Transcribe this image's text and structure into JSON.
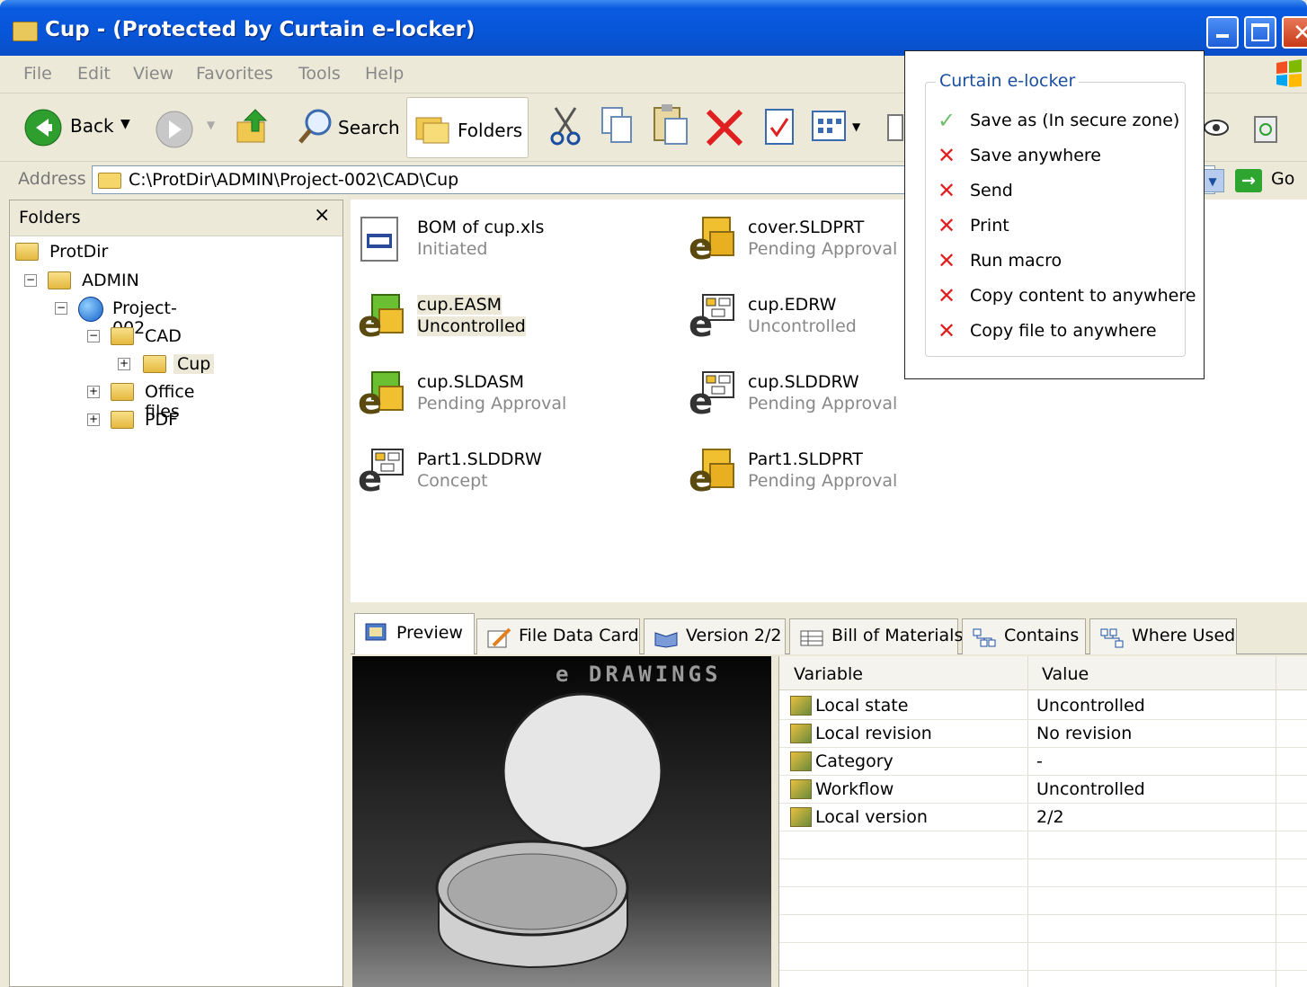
{
  "window": {
    "title": "Cup - (Protected by Curtain e-locker)"
  },
  "menu": [
    "File",
    "Edit",
    "View",
    "Favorites",
    "Tools",
    "Help"
  ],
  "toolbar": {
    "back": "Back",
    "search": "Search",
    "folders": "Folders",
    "go": "Go"
  },
  "address": {
    "label": "Address",
    "path": "C:\\ProtDir\\ADMIN\\Project-002\\CAD\\Cup"
  },
  "folders_pane": {
    "title": "Folders",
    "close": "×",
    "tree": [
      {
        "label": "ProtDir",
        "expander": ""
      },
      {
        "label": "ADMIN",
        "expander": "−"
      },
      {
        "label": "Project-002",
        "expander": "−"
      },
      {
        "label": "CAD",
        "expander": "−"
      },
      {
        "label": "Cup",
        "expander": "+"
      },
      {
        "label": "Office files",
        "expander": "+"
      },
      {
        "label": "PDF",
        "expander": "+"
      }
    ]
  },
  "files": [
    {
      "name": "BOM of cup.xls",
      "status": "Initiated",
      "icon": "excel-file-icon"
    },
    {
      "name": "cover.SLDPRT",
      "status": "Pending Approval",
      "icon": "edrawings-part-icon"
    },
    {
      "name": "cup.EASM",
      "status": "Uncontrolled",
      "icon": "edrawings-assembly-icon"
    },
    {
      "name": "cup.EDRW",
      "status": "Uncontrolled",
      "icon": "edrawings-drawing-icon"
    },
    {
      "name": "cup.SLDASM",
      "status": "Pending Approval",
      "icon": "edrawings-assembly-icon"
    },
    {
      "name": "cup.SLDDRW",
      "status": "Pending Approval",
      "icon": "edrawings-drawing-icon"
    },
    {
      "name": "Part1.SLDDRW",
      "status": "Concept",
      "icon": "edrawings-drawing-icon"
    },
    {
      "name": "Part1.SLDPRT",
      "status": "Pending Approval",
      "icon": "edrawings-part-icon"
    }
  ],
  "tabs": [
    "Preview",
    "File Data Card",
    "Version 2/2",
    "Bill of Materials",
    "Contains",
    "Where Used"
  ],
  "preview": {
    "watermark": "e DRAWINGS"
  },
  "datagrid": {
    "headers": [
      "Variable",
      "Value"
    ],
    "rows": [
      {
        "variable": "Local state",
        "value": "Uncontrolled"
      },
      {
        "variable": "Local revision",
        "value": "No revision"
      },
      {
        "variable": "Category",
        "value": "-"
      },
      {
        "variable": "Workflow",
        "value": "Uncontrolled"
      },
      {
        "variable": "Local version",
        "value": "2/2"
      }
    ]
  },
  "elocker": {
    "title": "Curtain e-locker",
    "items": [
      {
        "label": "Save as (In secure zone)",
        "allowed": true,
        "mark": "✓"
      },
      {
        "label": "Save anywhere",
        "allowed": false,
        "mark": "✕"
      },
      {
        "label": "Send",
        "allowed": false,
        "mark": "✕"
      },
      {
        "label": "Print",
        "allowed": false,
        "mark": "✕"
      },
      {
        "label": "Run macro",
        "allowed": false,
        "mark": "✕"
      },
      {
        "label": "Copy content to anywhere",
        "allowed": false,
        "mark": "✕"
      },
      {
        "label": "Copy file to anywhere",
        "allowed": false,
        "mark": "✕"
      }
    ]
  },
  "colors": {
    "title_bar": "#0a5ae0",
    "allowed": "#6cc06c",
    "denied": "#e02020",
    "legend": "#1a4fa0"
  }
}
